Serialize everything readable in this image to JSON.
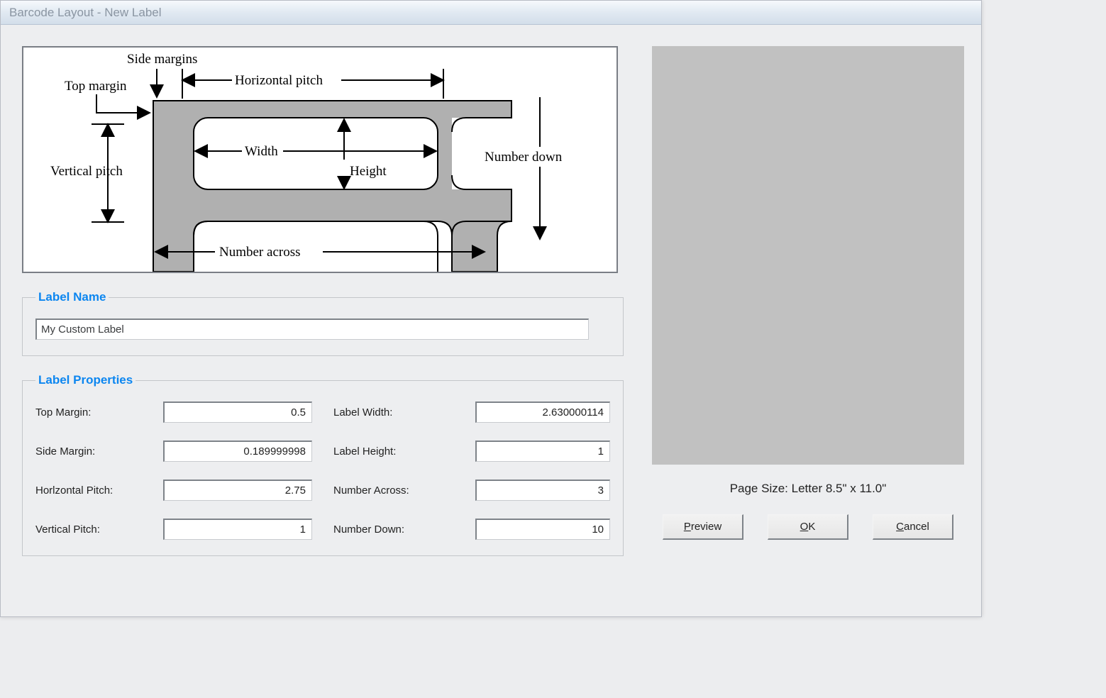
{
  "window": {
    "title": "Barcode Layout - New Label"
  },
  "diagram": {
    "side_margins": "Side margins",
    "top_margin": "Top margin",
    "horizontal_pitch": "Horizontal pitch",
    "vertical_pitch": "Vertical pitch",
    "width": "Width",
    "height": "Height",
    "number_down": "Number down",
    "number_across": "Number across"
  },
  "group_label_name": {
    "legend": "Label Name",
    "value": "My Custom Label"
  },
  "group_props": {
    "legend": "Label Properties",
    "top_margin": {
      "label": "Top Margin:",
      "value": "0.5"
    },
    "side_margin": {
      "label": "Side Margin:",
      "value": "0.189999998"
    },
    "horizontal_pitch": {
      "label": "Horlzontal Pitch:",
      "value": "2.75"
    },
    "vertical_pitch": {
      "label": "Vertical Pitch:",
      "value": "1"
    },
    "label_width": {
      "label": "Label Width:",
      "value": "2.630000114"
    },
    "label_height": {
      "label": "Label Height:",
      "value": "1"
    },
    "number_across": {
      "label": "Number Across:",
      "value": "3"
    },
    "number_down": {
      "label": "Number Down:",
      "value": "10"
    }
  },
  "preview": {
    "page_size": "Page Size: Letter 8.5\" x 11.0\""
  },
  "buttons": {
    "preview": "review",
    "ok": "K",
    "cancel": "ancel"
  }
}
